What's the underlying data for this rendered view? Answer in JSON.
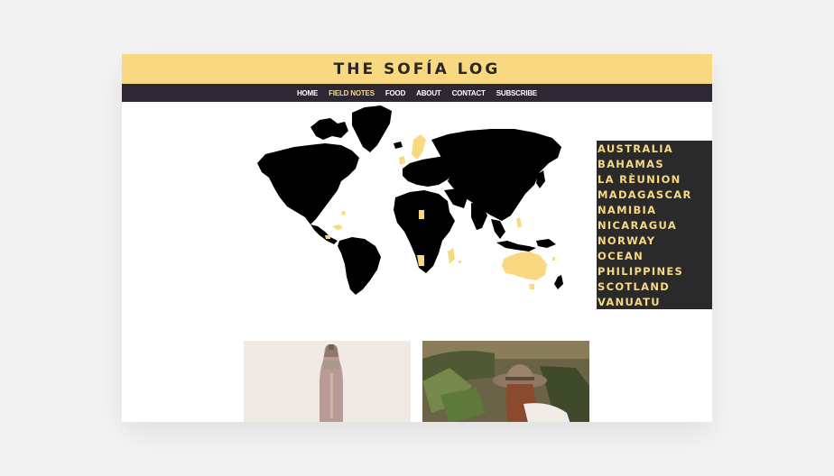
{
  "site": {
    "title": "THE SOFÍA LOG"
  },
  "nav": {
    "items": [
      {
        "label": "HOME",
        "active": false
      },
      {
        "label": "FIELD NOTES",
        "active": true
      },
      {
        "label": "FOOD",
        "active": false
      },
      {
        "label": "ABOUT",
        "active": false
      },
      {
        "label": "CONTACT",
        "active": false
      },
      {
        "label": "SUBSCRIBE",
        "active": false
      }
    ]
  },
  "countries": [
    "AUSTRALIA",
    "BAHAMAS",
    "LA RÈUNION",
    "MADAGASCAR",
    "NAMIBIA",
    "NICARAGUA",
    "NORWAY",
    "OCEAN",
    "PHILIPPINES",
    "SCOTLAND",
    "VANUATU"
  ],
  "colors": {
    "accent_yellow": "#f8d982",
    "nav_dark": "#2d2833",
    "list_dark": "#2a2a2a",
    "map_land": "#000000",
    "map_visited": "#f8d982"
  },
  "posts": [
    {
      "image": "champagne-bottle-photo"
    },
    {
      "image": "traveler-hat-plants-photo"
    }
  ]
}
